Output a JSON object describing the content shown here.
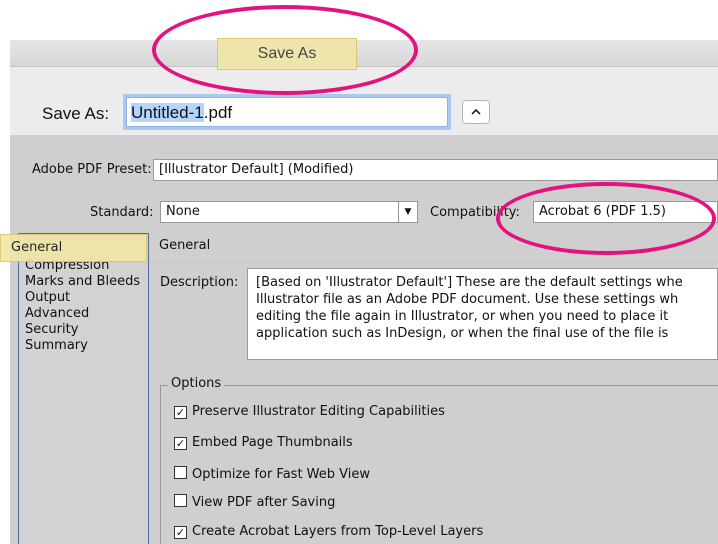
{
  "sheet": {
    "title": "Save As",
    "saveas_label": "Save As:",
    "filename_base": "Untitled-1",
    "filename_ext": ".pdf",
    "expand_icon": "chevron-up-icon"
  },
  "preset": {
    "label": "Adobe PDF Preset:",
    "value": "[Illustrator Default] (Modified)"
  },
  "standard": {
    "label": "Standard:",
    "value": "None"
  },
  "compatibility": {
    "label": "Compatibility:",
    "value": "Acrobat 6 (PDF 1.5)"
  },
  "nav": {
    "items": [
      "General",
      "Compression",
      "Marks and Bleeds",
      "Output",
      "Advanced",
      "Security",
      "Summary"
    ]
  },
  "general": {
    "section_title": "General",
    "description_label": "Description:",
    "description_lines": [
      "[Based on 'Illustrator Default'] These are the default settings whe",
      "Illustrator file as an Adobe PDF document. Use these settings wh",
      "editing the file again in Illustrator, or when you need to place it",
      "application such as InDesign, or when the final use of the file is"
    ]
  },
  "options": {
    "legend": "Options",
    "items": [
      {
        "label": "Preserve Illustrator Editing Capabilities",
        "checked": true
      },
      {
        "label": "Embed Page Thumbnails",
        "checked": true
      },
      {
        "label": "Optimize for Fast Web View",
        "checked": false
      },
      {
        "label": "View PDF after Saving",
        "checked": false
      },
      {
        "label": "Create Acrobat Layers from Top-Level Layers",
        "checked": true
      }
    ]
  },
  "colors": {
    "annotation": "#e4127e",
    "highlight": "#f2e7a5"
  }
}
